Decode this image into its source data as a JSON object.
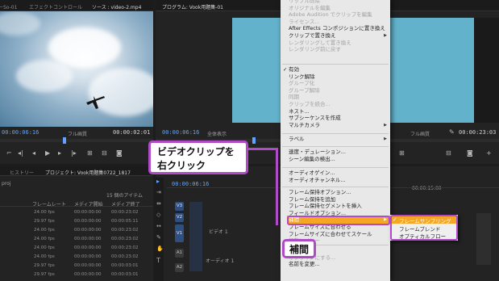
{
  "source_panel": {
    "tabs": [
      "ーSo-01",
      "エフェクトコントロール",
      "ソース : video-2.mp4"
    ],
    "current_time": "00:00:06:16",
    "zoom": "フル画質",
    "duration": "00:00:02:01"
  },
  "program_panel": {
    "tab": "プログラム: Vook用題集-01",
    "current_time": "00:00:06:16",
    "fit": "全体表示",
    "zoom": "フル画質",
    "duration": "00:00:23:03"
  },
  "project_panel": {
    "tabs": [
      "ヒストリー",
      "プロジェクト: Vook用題集0722_1817"
    ],
    "file": "proj",
    "item_count": "15 個のアイテム",
    "columns": [
      "フレームレート",
      "メディア開始",
      "メディア終了"
    ],
    "rows": [
      {
        "fps": "24.00 fps",
        "start": "00:00:00:00",
        "end": "00:00:23:02"
      },
      {
        "fps": "29.97 fps",
        "start": "00:00:00:00",
        "end": "00:00:05:11"
      },
      {
        "fps": "24.00 fps",
        "start": "00:00:00:00",
        "end": "00:00:23:02"
      },
      {
        "fps": "24.00 fps",
        "start": "00:00:00:00",
        "end": "00:00:23:02"
      },
      {
        "fps": "24.00 fps",
        "start": "00:00:00:00",
        "end": "00:00:23:02"
      },
      {
        "fps": "24.00 fps",
        "start": "00:00:00:00",
        "end": "00:00:23:02"
      },
      {
        "fps": "29.97 fps",
        "start": "00:00:00:00",
        "end": "00:00:03:01"
      },
      {
        "fps": "29.97 fps",
        "start": "00:00:00:00",
        "end": "00:00:03:01"
      }
    ]
  },
  "timeline": {
    "current_time": "00:00:06:16",
    "ruler_time": "00:00:15:00",
    "video_tracks": [
      "V3",
      "V2",
      "V1"
    ],
    "audio_tracks": [
      "A1",
      "A2"
    ],
    "track_names": {
      "v1": "ビデオ 1",
      "a1": "オーディオ 1"
    }
  },
  "context_menu": {
    "items_top": [
      {
        "label": "リップル削除",
        "disabled": true
      },
      {
        "label": "オリジナルを編集",
        "disabled": true
      },
      {
        "label": "Adobe Audition でクリップを編集",
        "disabled": true
      },
      {
        "label": "ライセンス...",
        "disabled": true
      },
      {
        "label": "After Effects コンポジションに置き換え",
        "disabled": false
      },
      {
        "label": "クリップで置き換え",
        "disabled": false,
        "submenu": true
      },
      {
        "label": "レンダリングして置き換え",
        "disabled": true
      },
      {
        "label": "レンダリング前に戻す",
        "disabled": true
      }
    ],
    "items_mid": [
      {
        "label": "有効",
        "checked": true
      },
      {
        "label": "リンク解除"
      },
      {
        "label": "グループ化",
        "disabled": true
      },
      {
        "label": "グループ解除",
        "disabled": true
      },
      {
        "label": "同期",
        "disabled": true
      },
      {
        "label": "クリップを統合...",
        "disabled": true
      },
      {
        "label": "ネスト..."
      },
      {
        "label": "サブシーケンスを作成"
      },
      {
        "label": "マルチカメラ",
        "submenu": true
      }
    ],
    "items_label": [
      {
        "label": "ラベル",
        "submenu": true
      }
    ],
    "items_speed": [
      {
        "label": "速度・デュレーション..."
      },
      {
        "label": "シーン編集の検出..."
      }
    ],
    "items_audio": [
      {
        "label": "オーディオゲイン..."
      },
      {
        "label": "オーディオチャンネル..."
      }
    ],
    "items_frame": [
      {
        "label": "フレーム保持オプション..."
      },
      {
        "label": "フレーム保持を追加"
      },
      {
        "label": "フレーム保持セグメントを挿入"
      },
      {
        "label": "フィールドオプション..."
      },
      {
        "label": "補間",
        "submenu": true,
        "highlighted": true
      },
      {
        "label": "フレームサイズに合わせる"
      },
      {
        "label": "フレームサイズに合わせてスケール"
      },
      {
        "label": "調整レイヤー",
        "disabled": true
      }
    ],
    "items_bottom": [
      {
        "label": "リンク",
        "disabled": true
      },
      {
        "label": "オフラインにする...",
        "disabled": true
      },
      {
        "label": "名前を変更..."
      }
    ]
  },
  "submenu": {
    "items": [
      {
        "label": "フレームサンプリング",
        "checked": true,
        "highlighted": true
      },
      {
        "label": "フレームブレンド"
      },
      {
        "label": "オプティカルフロー"
      }
    ]
  },
  "callouts": {
    "main_line1": "ビデオクリップを",
    "main_line2": "右クリック",
    "interp": "補間"
  },
  "colors": {
    "accent": "#b04bc8",
    "highlight": "#f5a623",
    "program_bg": "#62b2cb",
    "timecode": "#5fa2ff"
  }
}
